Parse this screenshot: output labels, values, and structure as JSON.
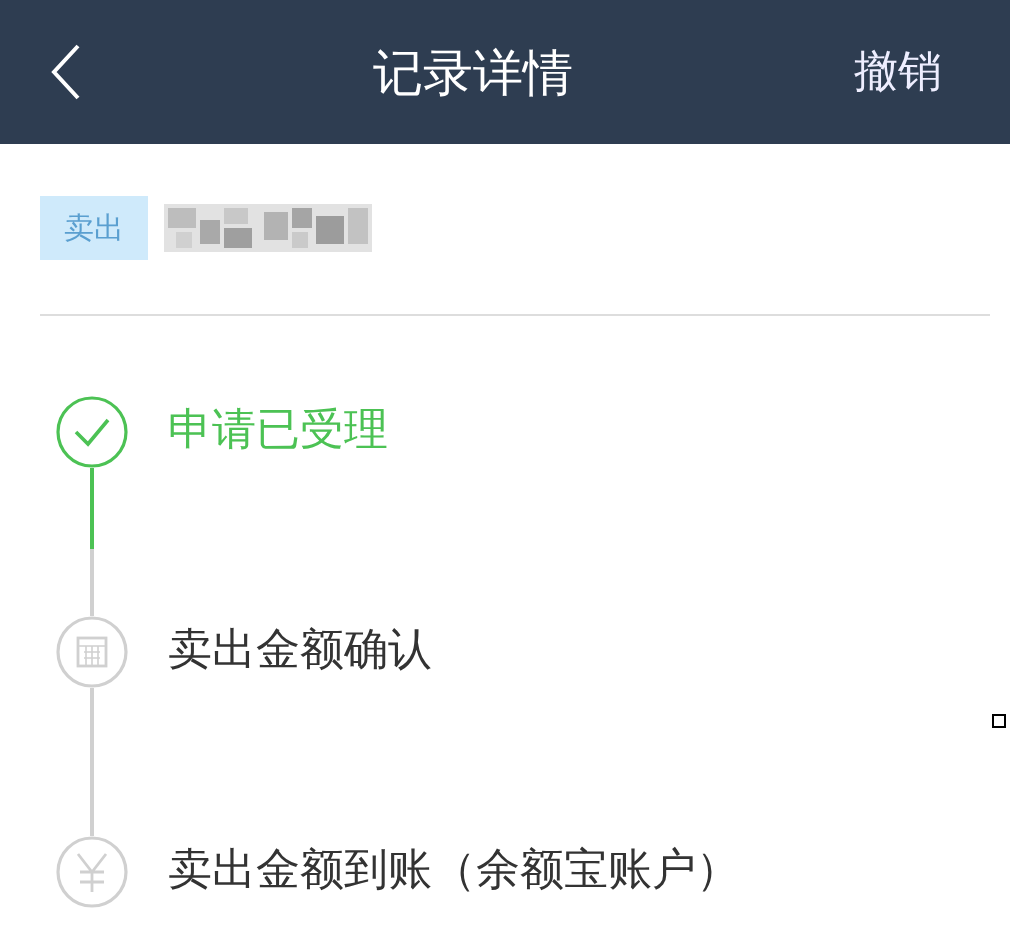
{
  "header": {
    "title": "记录详情",
    "action": "撤销"
  },
  "record": {
    "tag": "卖出"
  },
  "steps": [
    {
      "label": "申请已受理",
      "kind": "check",
      "done": true
    },
    {
      "label": "卖出金额确认",
      "kind": "calculator",
      "done": false
    },
    {
      "label": "卖出金额到账（余额宝账户）",
      "kind": "yen",
      "done": false
    }
  ]
}
